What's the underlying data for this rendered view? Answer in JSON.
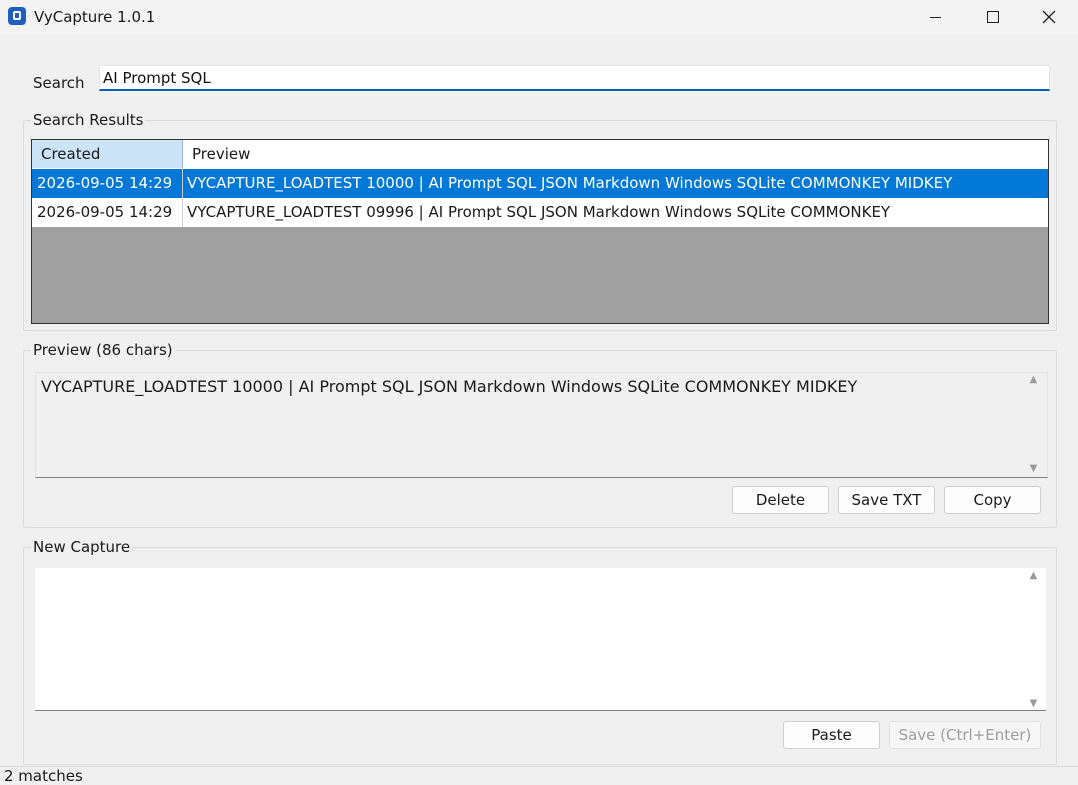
{
  "window": {
    "title": "VyCapture 1.0.1"
  },
  "search": {
    "label": "Search",
    "value": "AI Prompt SQL"
  },
  "results": {
    "label": "Search Results",
    "columns": [
      "Created",
      "Preview"
    ],
    "rows": [
      {
        "created": "2026-09-05 14:29",
        "preview": "VYCAPTURE_LOADTEST 10000 | AI Prompt SQL JSON Markdown Windows SQLite COMMONKEY MIDKEY",
        "selected": true
      },
      {
        "created": "2026-09-05 14:29",
        "preview": "VYCAPTURE_LOADTEST 09996 | AI Prompt SQL JSON Markdown Windows SQLite COMMONKEY",
        "selected": false
      }
    ]
  },
  "preview": {
    "label": "Preview (86 chars)",
    "text": "VYCAPTURE_LOADTEST 10000 | AI Prompt SQL JSON Markdown Windows SQLite COMMONKEY MIDKEY",
    "buttons": {
      "delete": "Delete",
      "save_txt": "Save TXT",
      "copy": "Copy"
    }
  },
  "capture": {
    "label": "New Capture",
    "text": "",
    "buttons": {
      "paste": "Paste",
      "save": "Save  (Ctrl+Enter)"
    },
    "save_enabled": false
  },
  "status": {
    "text": "2 matches"
  },
  "colors": {
    "accent": "#0078d7",
    "header_selected": "#cce4f7",
    "table_empty": "#a0a0a0"
  }
}
